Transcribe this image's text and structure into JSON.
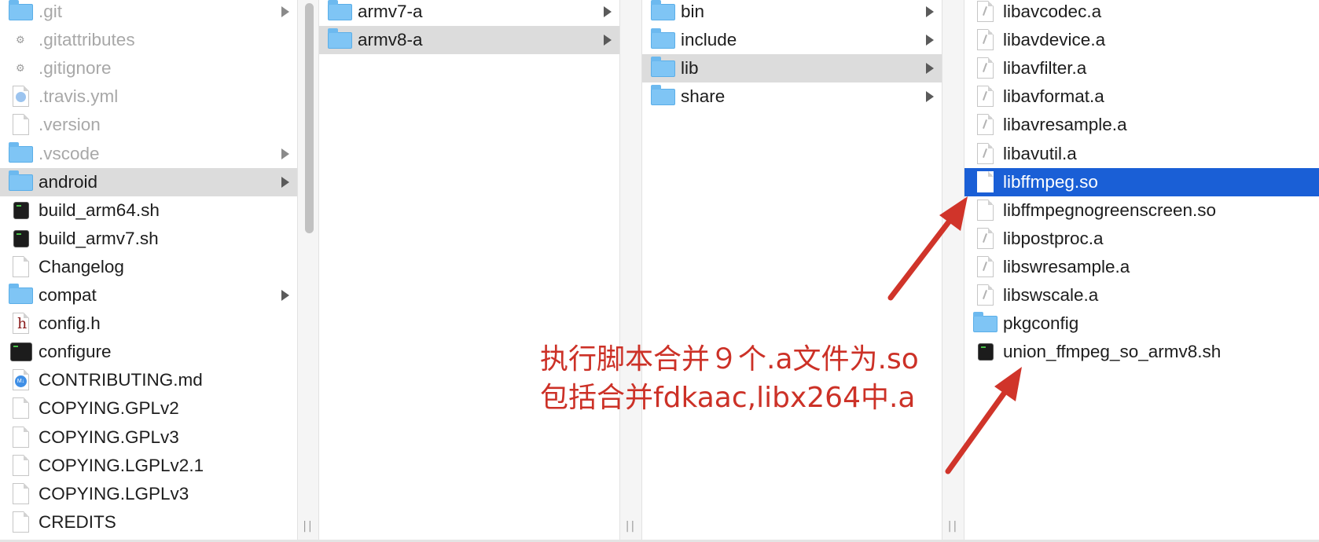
{
  "columns": [
    {
      "id": "col1",
      "items": [
        {
          "name": ".git",
          "icon": "folder-icon",
          "dim": true,
          "chevron": true
        },
        {
          "name": ".gitattributes",
          "icon": "gear-file-icon",
          "dim": true
        },
        {
          "name": ".gitignore",
          "icon": "gear-file-icon",
          "dim": true
        },
        {
          "name": ".travis.yml",
          "icon": "yml-file-icon",
          "dim": true
        },
        {
          "name": ".version",
          "icon": "file-icon",
          "dim": true
        },
        {
          "name": ".vscode",
          "icon": "folder-icon",
          "dim": true,
          "chevron": true
        },
        {
          "name": "android",
          "icon": "folder-icon",
          "selected": true,
          "chevron": true
        },
        {
          "name": "build_arm64.sh",
          "icon": "shell-script-icon"
        },
        {
          "name": "build_armv7.sh",
          "icon": "shell-script-icon"
        },
        {
          "name": "Changelog",
          "icon": "file-icon"
        },
        {
          "name": "compat",
          "icon": "folder-icon",
          "chevron": true
        },
        {
          "name": "config.h",
          "icon": "header-file-icon"
        },
        {
          "name": "configure",
          "icon": "terminal-exec-icon"
        },
        {
          "name": "CONTRIBUTING.md",
          "icon": "markdown-file-icon"
        },
        {
          "name": "COPYING.GPLv2",
          "icon": "file-icon"
        },
        {
          "name": "COPYING.GPLv3",
          "icon": "file-icon"
        },
        {
          "name": "COPYING.LGPLv2.1",
          "icon": "file-icon"
        },
        {
          "name": "COPYING.LGPLv3",
          "icon": "file-icon"
        },
        {
          "name": "CREDITS",
          "icon": "file-icon"
        }
      ]
    },
    {
      "id": "col2",
      "items": [
        {
          "name": "armv7-a",
          "icon": "folder-icon",
          "chevron": true
        },
        {
          "name": "armv8-a",
          "icon": "folder-icon",
          "selected": true,
          "chevron": true
        }
      ]
    },
    {
      "id": "col3",
      "items": [
        {
          "name": "bin",
          "icon": "folder-icon",
          "chevron": true
        },
        {
          "name": "include",
          "icon": "folder-icon",
          "chevron": true
        },
        {
          "name": "lib",
          "icon": "folder-icon",
          "selected": true,
          "chevron": true
        },
        {
          "name": "share",
          "icon": "folder-icon",
          "chevron": true
        }
      ]
    },
    {
      "id": "col4",
      "items": [
        {
          "name": "libavcodec.a",
          "icon": "archive-file-icon"
        },
        {
          "name": "libavdevice.a",
          "icon": "archive-file-icon"
        },
        {
          "name": "libavfilter.a",
          "icon": "archive-file-icon"
        },
        {
          "name": "libavformat.a",
          "icon": "archive-file-icon"
        },
        {
          "name": "libavresample.a",
          "icon": "archive-file-icon"
        },
        {
          "name": "libavutil.a",
          "icon": "archive-file-icon"
        },
        {
          "name": "libffmpeg.so",
          "icon": "file-icon",
          "active": true
        },
        {
          "name": "libffmpegnogreenscreen.so",
          "icon": "file-icon"
        },
        {
          "name": "libpostproc.a",
          "icon": "archive-file-icon"
        },
        {
          "name": "libswresample.a",
          "icon": "archive-file-icon"
        },
        {
          "name": "libswscale.a",
          "icon": "archive-file-icon"
        },
        {
          "name": "pkgconfig",
          "icon": "folder-icon"
        },
        {
          "name": "union_ffmpeg_so_armv8.sh",
          "icon": "shell-script-icon"
        }
      ]
    }
  ],
  "column_grip": "||",
  "annotation": {
    "line1": "执行脚本合并９个.a文件为.so",
    "line2": "包括合并fdkaac,libx264中.a",
    "color": "#cc3127"
  },
  "colors": {
    "selection_gray": "#dcdcdc",
    "selection_blue": "#1a5fd6",
    "folder_blue": "#7fc5f5"
  }
}
